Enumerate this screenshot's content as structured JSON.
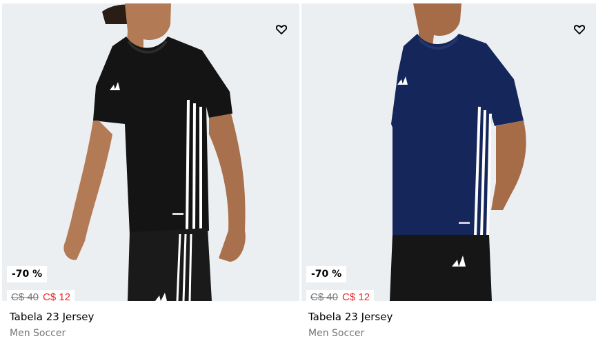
{
  "products": [
    {
      "badge": "-70 %",
      "old_price": "C$ 40",
      "new_price": "C$ 12",
      "name": "Tabela 23 Jersey",
      "category": "Men Soccer",
      "icon": "heart-outline-icon",
      "shirt_color": "#141414",
      "shorts_color": "#1a1a1a"
    },
    {
      "badge": "-70 %",
      "old_price": "C$ 40",
      "new_price": "C$ 12",
      "name": "Tabela 23 Jersey",
      "category": "Men Soccer",
      "icon": "heart-outline-icon",
      "shirt_color": "#15265a",
      "shorts_color": "#161616"
    }
  ],
  "colors": {
    "sale": "#e32b2b",
    "muted": "#767677",
    "image_bg": "#eceff1"
  }
}
